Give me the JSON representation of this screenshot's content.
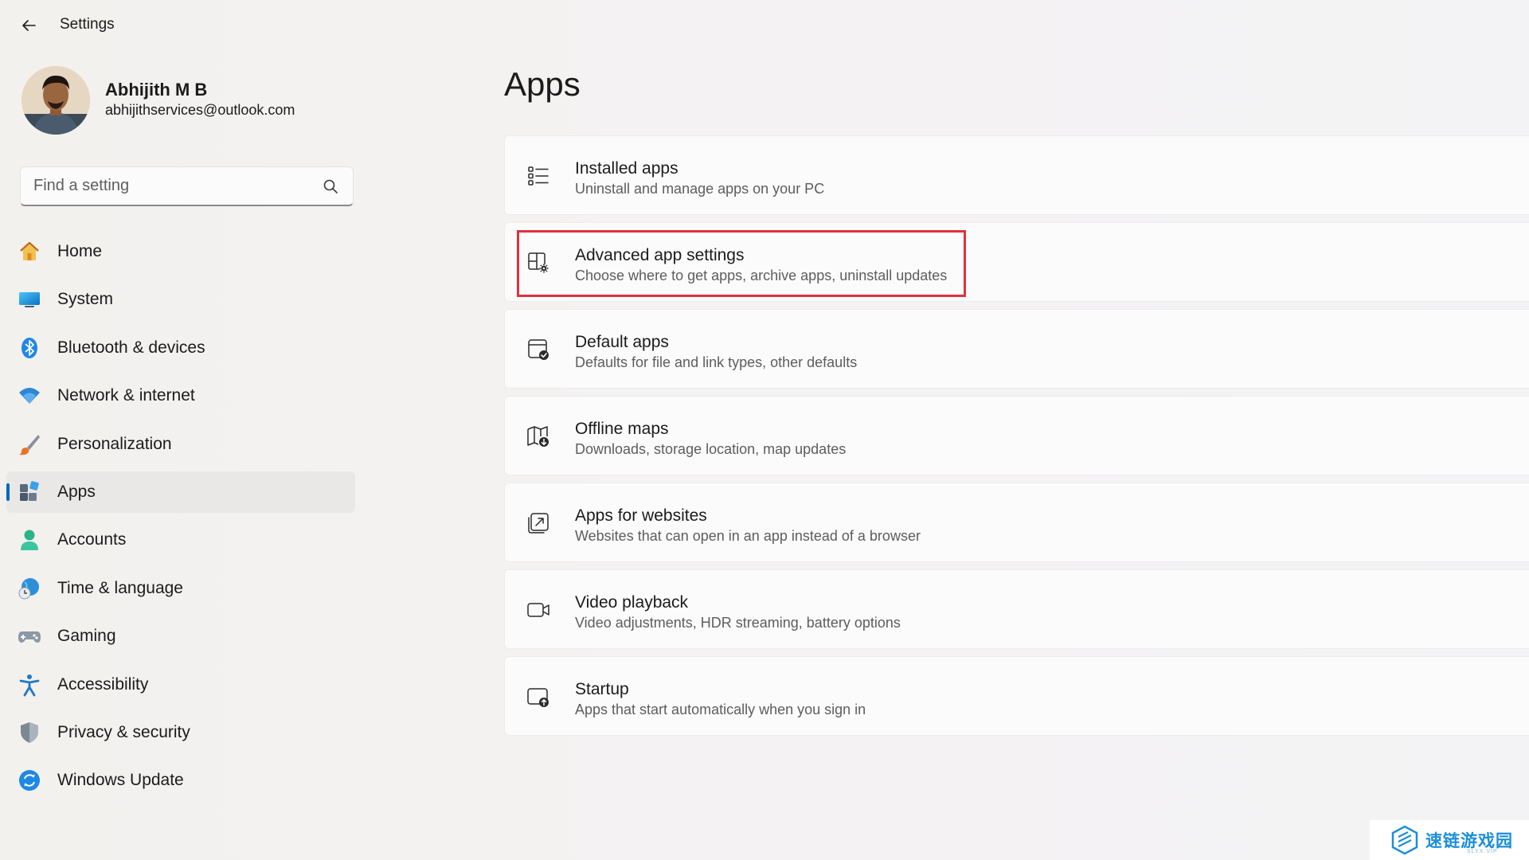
{
  "window": {
    "title": "Settings"
  },
  "profile": {
    "name": "Abhijith M B",
    "email": "abhijithservices@outlook.com"
  },
  "search": {
    "placeholder": "Find a setting"
  },
  "sidebar": {
    "items": [
      {
        "label": "Home",
        "icon": "home-icon"
      },
      {
        "label": "System",
        "icon": "system-icon"
      },
      {
        "label": "Bluetooth & devices",
        "icon": "bluetooth-icon"
      },
      {
        "label": "Network & internet",
        "icon": "wifi-icon"
      },
      {
        "label": "Personalization",
        "icon": "brush-icon"
      },
      {
        "label": "Apps",
        "icon": "apps-icon",
        "selected": true
      },
      {
        "label": "Accounts",
        "icon": "person-icon"
      },
      {
        "label": "Time & language",
        "icon": "globe-clock-icon"
      },
      {
        "label": "Gaming",
        "icon": "gamepad-icon"
      },
      {
        "label": "Accessibility",
        "icon": "accessibility-icon"
      },
      {
        "label": "Privacy & security",
        "icon": "shield-icon"
      },
      {
        "label": "Windows Update",
        "icon": "update-icon"
      }
    ]
  },
  "main": {
    "title": "Apps",
    "cards": [
      {
        "title": "Installed apps",
        "description": "Uninstall and manage apps on your PC",
        "icon": "list-icon"
      },
      {
        "title": "Advanced app settings",
        "description": "Choose where to get apps, archive apps, uninstall updates",
        "icon": "app-gear-icon",
        "highlighted": true
      },
      {
        "title": "Default apps",
        "description": "Defaults for file and link types, other defaults",
        "icon": "default-apps-icon"
      },
      {
        "title": "Offline maps",
        "description": "Downloads, storage location, map updates",
        "icon": "map-download-icon"
      },
      {
        "title": "Apps for websites",
        "description": "Websites that can open in an app instead of a browser",
        "icon": "open-in-app-icon"
      },
      {
        "title": "Video playback",
        "description": "Video adjustments, HDR streaming, battery options",
        "icon": "video-icon"
      },
      {
        "title": "Startup",
        "description": "Apps that start automatically when you sign in",
        "icon": "startup-icon"
      }
    ]
  },
  "watermark": {
    "text": "速链游戏园",
    "sub": "SLYX.VIP"
  },
  "colors": {
    "accent": "#0067c0",
    "highlight": "#e0323c"
  }
}
